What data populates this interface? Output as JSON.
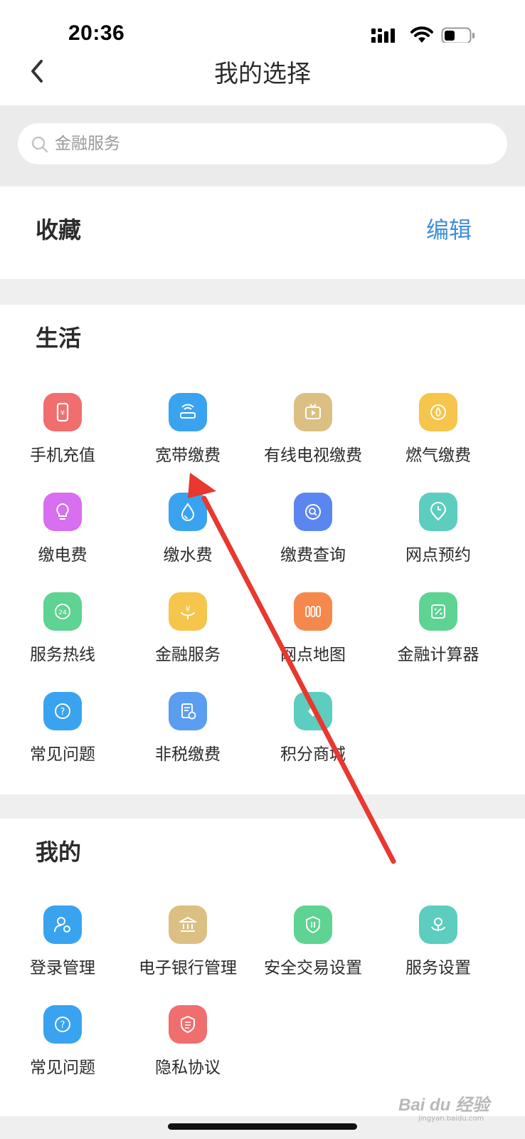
{
  "status_bar": {
    "time": "20:36"
  },
  "nav": {
    "title": "我的选择"
  },
  "search": {
    "placeholder": "金融服务"
  },
  "favorites": {
    "title": "收藏",
    "edit_label": "编辑"
  },
  "life": {
    "title": "生活",
    "items": [
      {
        "label": "手机充值",
        "icon": "phone-recharge-icon",
        "color": "#f06e6e"
      },
      {
        "label": "宽带缴费",
        "icon": "broadband-icon",
        "color": "#3aa3f0"
      },
      {
        "label": "有线电视缴费",
        "icon": "tv-icon",
        "color": "#dcbf83"
      },
      {
        "label": "燃气缴费",
        "icon": "gas-icon",
        "color": "#f5c54c"
      },
      {
        "label": "缴电费",
        "icon": "lightbulb-icon",
        "color": "#d86ef0"
      },
      {
        "label": "缴水费",
        "icon": "water-drop-icon",
        "color": "#3aa3f0"
      },
      {
        "label": "缴费查询",
        "icon": "query-icon",
        "color": "#5b86ef"
      },
      {
        "label": "网点预约",
        "icon": "location-clock-icon",
        "color": "#5ccdbf"
      },
      {
        "label": "服务热线",
        "icon": "hotline-24-icon",
        "color": "#5ed392"
      },
      {
        "label": "金融服务",
        "icon": "finance-hand-icon",
        "color": "#f5c54c"
      },
      {
        "label": "网点地图",
        "icon": "map-icon",
        "color": "#f5884c"
      },
      {
        "label": "金融计算器",
        "icon": "calculator-icon",
        "color": "#5ed392"
      },
      {
        "label": "常见问题",
        "icon": "question-icon",
        "color": "#3aa3f0"
      },
      {
        "label": "非税缴费",
        "icon": "tax-document-icon",
        "color": "#5b9df0"
      },
      {
        "label": "积分商城",
        "icon": "points-mall-icon",
        "color": "#5ccdbf"
      }
    ]
  },
  "mine": {
    "title": "我的",
    "items": [
      {
        "label": "登录管理",
        "icon": "user-settings-icon",
        "color": "#3aa3f0"
      },
      {
        "label": "电子银行管理",
        "icon": "bank-icon",
        "color": "#dcbf83"
      },
      {
        "label": "安全交易设置",
        "icon": "shield-transfer-icon",
        "color": "#5ed392"
      },
      {
        "label": "服务设置",
        "icon": "service-pin-icon",
        "color": "#5ccdbf"
      },
      {
        "label": "常见问题",
        "icon": "question-icon",
        "color": "#3aa3f0"
      },
      {
        "label": "隐私协议",
        "icon": "privacy-shield-icon",
        "color": "#f06e6e"
      }
    ]
  },
  "watermark": {
    "logo": "Bai du 经验",
    "sub": "jingyan.baidu.com"
  },
  "annotation": {
    "arrow_color": "#e8382f"
  }
}
